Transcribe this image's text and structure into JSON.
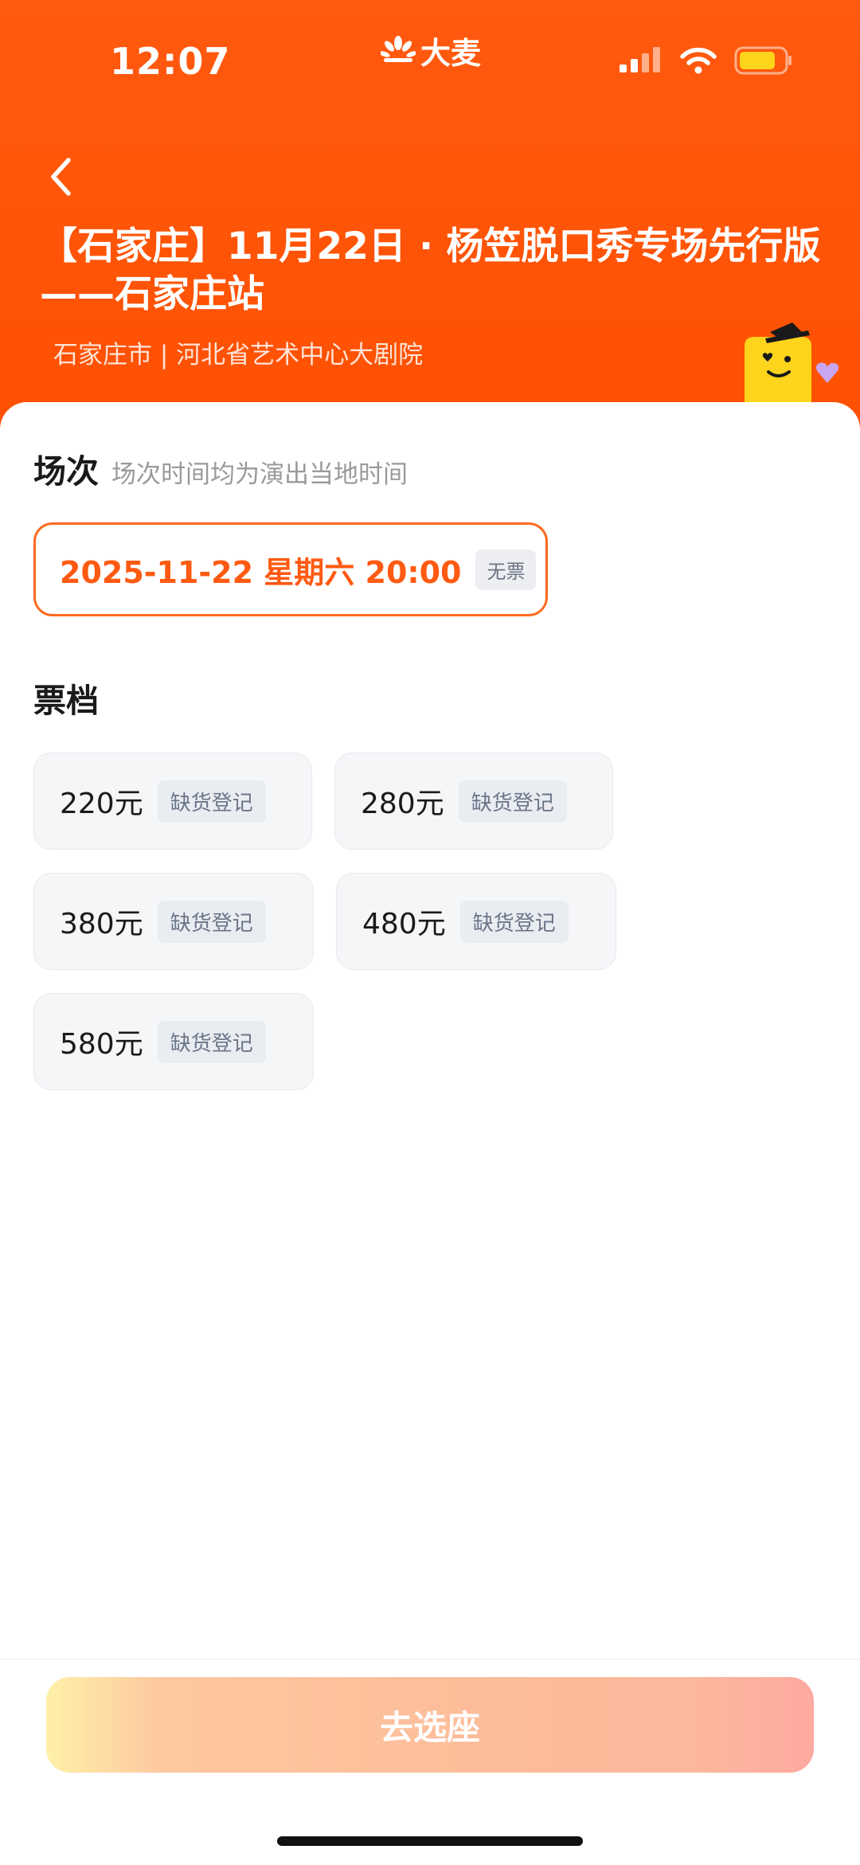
{
  "status_bar": {
    "time": "12:07",
    "brand": "大麦"
  },
  "header": {
    "title_line1": "【石家庄】11月22日 · 杨笠脱口秀专场先行版",
    "title_line2": "——石家庄站",
    "venue": "石家庄市 | 河北省艺术中心大剧院"
  },
  "session": {
    "title": "场次",
    "subtitle": "场次时间均为演出当地时间",
    "date": "2025-11-22 星期六 20:00",
    "status_tag": "无票"
  },
  "tickets": {
    "title": "票档",
    "items": [
      {
        "price": "220元",
        "tag": "缺货登记"
      },
      {
        "price": "280元",
        "tag": "缺货登记"
      },
      {
        "price": "380元",
        "tag": "缺货登记"
      },
      {
        "price": "480元",
        "tag": "缺货登记"
      },
      {
        "price": "580元",
        "tag": "缺货登记"
      }
    ]
  },
  "cta": {
    "label": "去选座"
  },
  "colors": {
    "brand_orange": "#ff5000",
    "accent": "#ff5a12"
  }
}
